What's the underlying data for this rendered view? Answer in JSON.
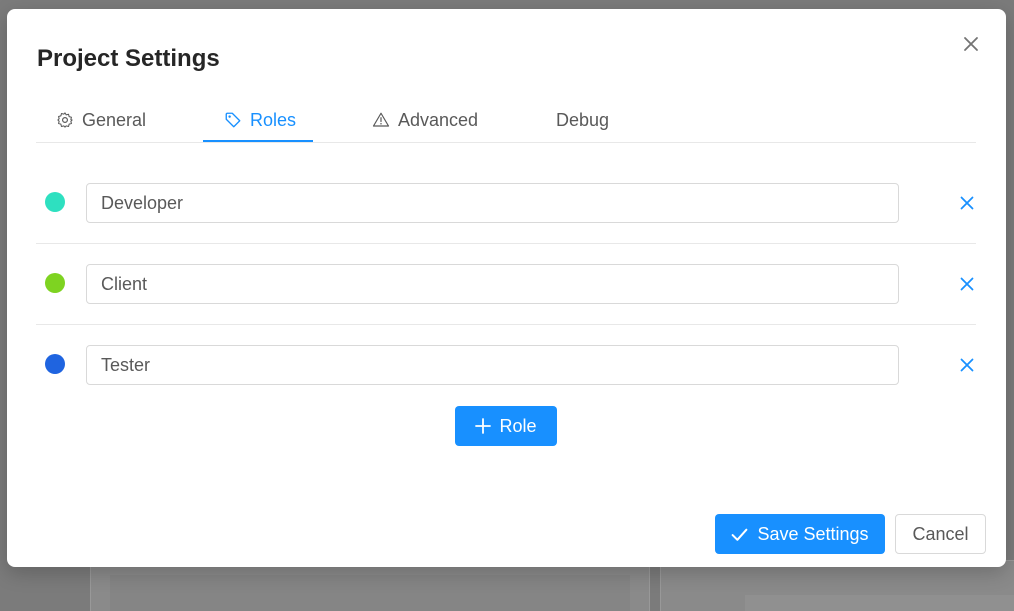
{
  "dialog": {
    "title": "Project Settings"
  },
  "tabs": [
    {
      "label": "General",
      "icon": "gear-icon",
      "active": false
    },
    {
      "label": "Roles",
      "icon": "tag-icon",
      "active": true
    },
    {
      "label": "Advanced",
      "icon": "warning-icon",
      "active": false
    },
    {
      "label": "Debug",
      "icon": "",
      "active": false
    }
  ],
  "roles": [
    {
      "name": "Developer",
      "color": "#2ee0c0"
    },
    {
      "name": "Client",
      "color": "#7ed321"
    },
    {
      "name": "Tester",
      "color": "#1f64e0"
    }
  ],
  "actions": {
    "add_role_label": "Role",
    "save_label": "Save Settings",
    "cancel_label": "Cancel"
  },
  "colors": {
    "accent": "#1890ff",
    "overlay": "#7b7b7b"
  }
}
